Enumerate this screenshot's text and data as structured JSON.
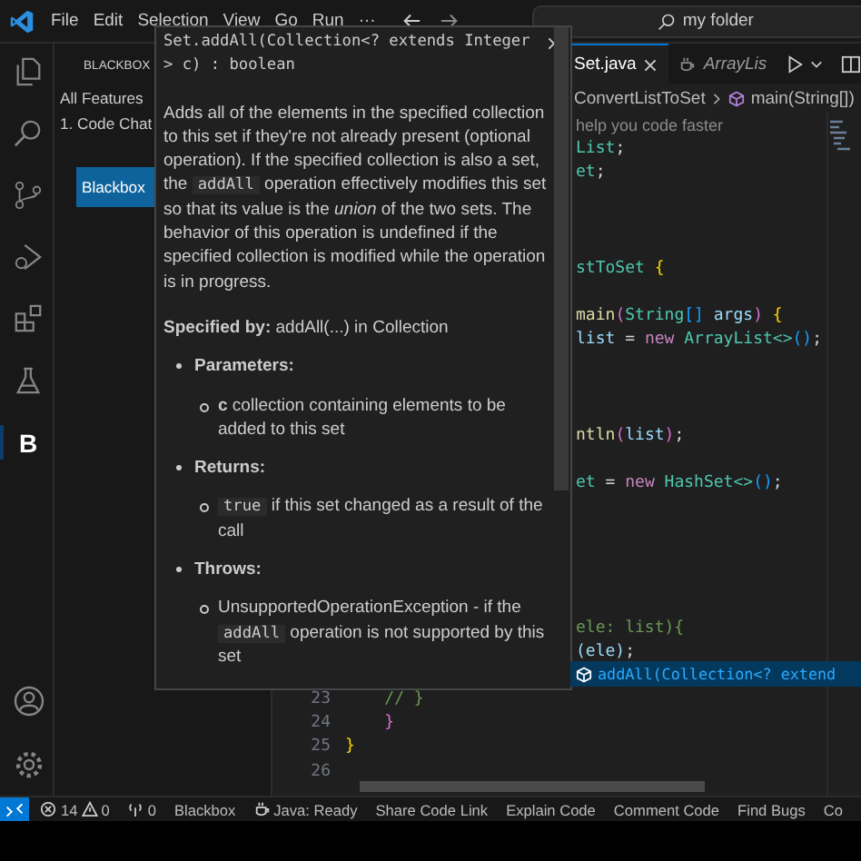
{
  "title_bar": {
    "menus": [
      "File",
      "Edit",
      "Selection",
      "View",
      "Go",
      "Run",
      "···"
    ],
    "search": {
      "value": "my folder"
    }
  },
  "activity_bar": [
    {
      "kind": "files",
      "selected": false
    },
    {
      "kind": "search",
      "selected": false
    },
    {
      "kind": "source-control",
      "selected": false
    },
    {
      "kind": "run-debug",
      "selected": false
    },
    {
      "kind": "extensions",
      "selected": false
    },
    {
      "kind": "testing",
      "selected": false
    },
    {
      "kind": "letter",
      "label": "B",
      "selected": true
    }
  ],
  "activity_bar_bottom": [
    {
      "kind": "account"
    },
    {
      "kind": "settings"
    }
  ],
  "sidebar": {
    "title": "BLACKBOX",
    "items": [
      "All Features",
      "1. Code Chat"
    ],
    "button": "Blackbox"
  },
  "tabs": [
    {
      "label": "Set.java",
      "selected": true,
      "preview": false
    },
    {
      "label": "ArrayLis",
      "selected": false,
      "preview": true
    }
  ],
  "breadcrumb": [
    "ConvertListToSet",
    "main(String[])"
  ],
  "code_lines": [
    {
      "kind": "hint",
      "tokens": [
        {
          "kind": "hint",
          "text": "help you code faster"
        }
      ]
    },
    {
      "kind": "partial",
      "tokens": [
        {
          "kind": "type",
          "text": "List"
        },
        {
          "kind": "plain",
          "text": ";"
        }
      ]
    },
    {
      "kind": "partial",
      "tokens": [
        {
          "kind": "type",
          "text": "et"
        },
        {
          "kind": "plain",
          "text": ";"
        }
      ]
    },
    {
      "kind": "blank"
    },
    {
      "kind": "blank"
    },
    {
      "kind": "blank"
    },
    {
      "kind": "partial",
      "tokens": [
        {
          "kind": "type",
          "text": "stToSet"
        },
        {
          "kind": "bracket",
          "text": " {"
        }
      ]
    },
    {
      "kind": "blank"
    },
    {
      "kind": "partial",
      "tokens": [
        {
          "kind": "func",
          "text": "main"
        },
        {
          "kind": "bracket2",
          "text": "("
        },
        {
          "kind": "type",
          "text": "String"
        },
        {
          "kind": "bracket3",
          "text": "[]"
        },
        {
          "kind": "var",
          "text": " args"
        },
        {
          "kind": "bracket2",
          "text": ")"
        },
        {
          "kind": "bracket",
          "text": " {"
        }
      ]
    },
    {
      "kind": "partial",
      "tokens": [
        {
          "kind": "var",
          "text": "list"
        },
        {
          "kind": "plain",
          "text": " = "
        },
        {
          "kind": "keyword",
          "text": "new"
        },
        {
          "kind": "type",
          "text": " ArrayList<>"
        },
        {
          "kind": "bracket3",
          "text": "()"
        },
        {
          "kind": "plain",
          "text": ";"
        }
      ]
    },
    {
      "kind": "blank"
    },
    {
      "kind": "blank"
    },
    {
      "kind": "blank"
    },
    {
      "kind": "partial",
      "tokens": [
        {
          "kind": "func",
          "text": "ntln"
        },
        {
          "kind": "bracket2",
          "text": "("
        },
        {
          "kind": "var",
          "text": "list"
        },
        {
          "kind": "bracket2",
          "text": ")"
        },
        {
          "kind": "plain",
          "text": ";"
        }
      ]
    },
    {
      "kind": "blank"
    },
    {
      "kind": "partial",
      "tokens": [
        {
          "kind": "type",
          "text": "et"
        },
        {
          "kind": "plain",
          "text": " = "
        },
        {
          "kind": "keyword",
          "text": "new"
        },
        {
          "kind": "type",
          "text": " HashSet<>"
        },
        {
          "kind": "bracket3",
          "text": "()"
        },
        {
          "kind": "plain",
          "text": ";"
        }
      ]
    },
    {
      "kind": "blank"
    },
    {
      "kind": "blank"
    },
    {
      "kind": "blank"
    },
    {
      "kind": "blank"
    },
    {
      "kind": "blank"
    },
    {
      "kind": "partial",
      "tokens": [
        {
          "kind": "comment",
          "text": "ele: list){"
        }
      ]
    },
    {
      "kind": "partial",
      "tokens": [
        {
          "kind": "var",
          "text": "(ele)"
        },
        {
          "kind": "plain",
          "text": ";"
        }
      ]
    },
    {
      "kind": "blank"
    },
    {
      "kind": "full",
      "number": "23",
      "tokens": [
        {
          "kind": "comment",
          "text": "    // }"
        }
      ]
    },
    {
      "kind": "full",
      "number": "24",
      "tokens": [
        {
          "kind": "bracket2",
          "text": "    }"
        }
      ]
    },
    {
      "kind": "full",
      "number": "25",
      "tokens": [
        {
          "kind": "bracket",
          "text": "}"
        }
      ]
    },
    {
      "kind": "full",
      "number": "26"
    }
  ],
  "suggestion": {
    "text": "addAll(Collection<? extend"
  },
  "hover": {
    "signature": [
      "Set.addAll(Collection<? extends Integer",
      "> c) : boolean"
    ],
    "description": [
      {
        "kind": "text",
        "text": "Adds all of the elements in the specified collection to this set if they're not already present (optional operation). If the specified collection is also a set, the"
      },
      {
        "kind": "code",
        "text": "addAll"
      },
      {
        "kind": "text",
        "text": "operation effectively modifies this set so that its value is the *union* of the two sets. The behavior of this operation is undefined if the specified collection is modified while the operation is in progress."
      }
    ],
    "specified_by": "**Specified by:** addAll(...) in Collection",
    "sections": [
      {
        "heading": "Parameters:",
        "item": [
          {
            "kind": "text",
            "text": "**c** collection containing elements to be added to this set"
          }
        ]
      },
      {
        "heading": "Returns:",
        "item": [
          {
            "kind": "code",
            "text": "true"
          },
          {
            "kind": "text",
            "text": "if this set changed as a result of the call"
          }
        ]
      },
      {
        "heading": "Throws:",
        "item": [
          {
            "kind": "text",
            "text": "UnsupportedOperationException - if the"
          },
          {
            "kind": "code",
            "text": "addAll"
          },
          {
            "kind": "text",
            "text": "operation is not supported by this set"
          }
        ]
      }
    ]
  },
  "status_bar": {
    "errors": "14",
    "warnings": "0",
    "ports": "0",
    "items": [
      {
        "kind": "plain",
        "text": "Blackbox"
      },
      {
        "kind": "java",
        "text": "Java: Ready"
      },
      {
        "kind": "plain",
        "text": "Share Code Link"
      },
      {
        "kind": "plain",
        "text": "Explain Code"
      },
      {
        "kind": "plain",
        "text": "Comment Code"
      },
      {
        "kind": "plain",
        "text": "Find Bugs"
      },
      {
        "kind": "plain",
        "text": "Co"
      }
    ]
  }
}
